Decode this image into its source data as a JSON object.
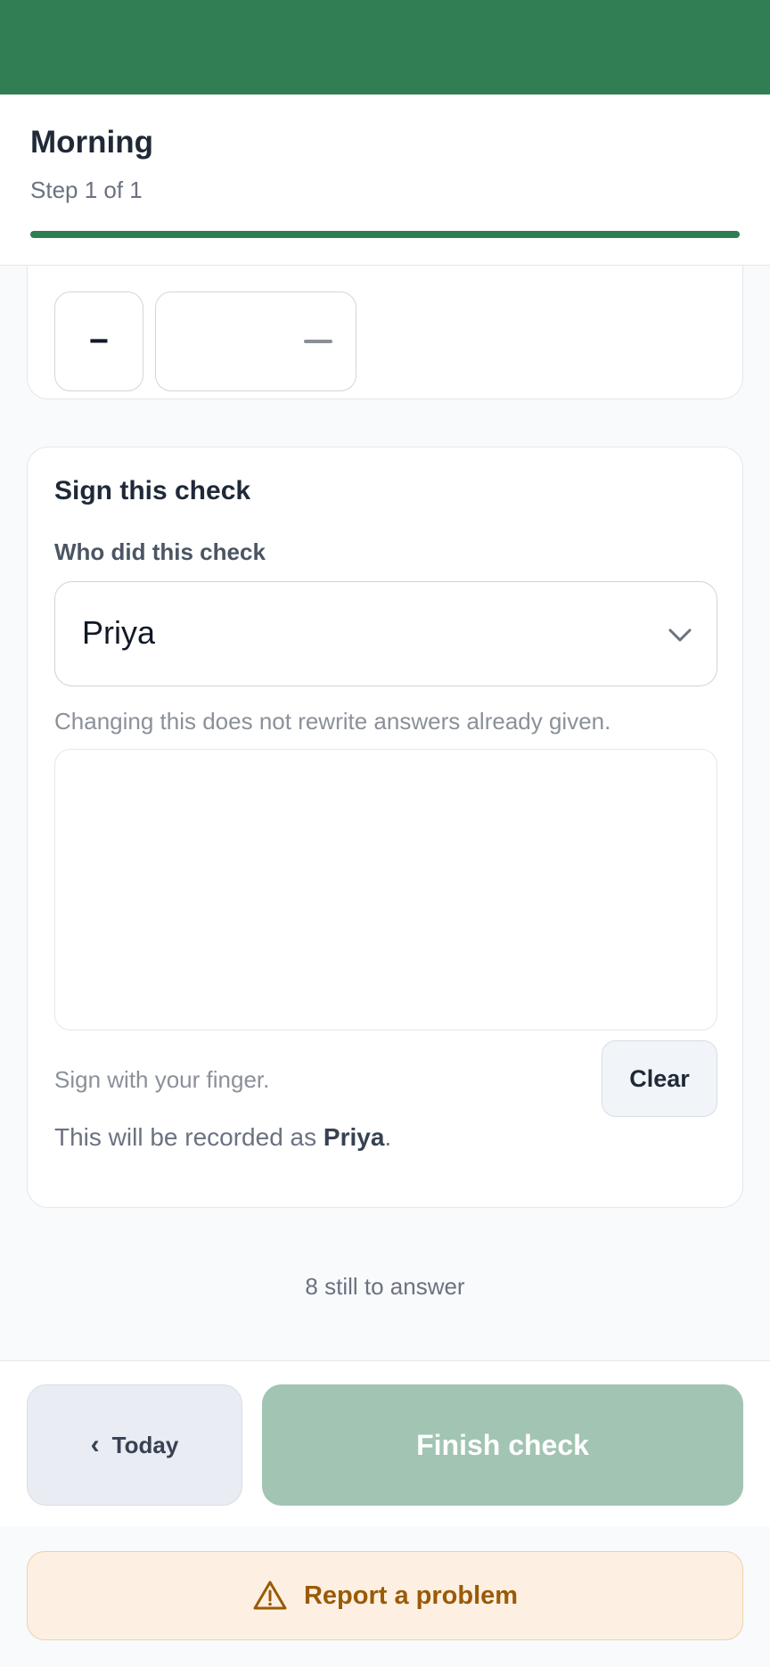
{
  "header": {
    "title": "Morning",
    "step": "Step 1 of 1",
    "progress": 1.0
  },
  "number_input": {
    "minus_label": "−",
    "value_placeholder": "—"
  },
  "sign_card": {
    "title": "Sign this check",
    "who_label": "Who did this check",
    "who_value": "Priya",
    "hint": "Changing this does not rewrite answers already given.",
    "finger_hint": "Sign with your finger.",
    "clear_label": "Clear",
    "recorded_prefix": "This will be recorded as ",
    "recorded_name": "Priya",
    "recorded_suffix": "."
  },
  "remaining_text": "8 still to answer",
  "footer": {
    "back_label": "Today",
    "back_icon": "chevron-left-icon",
    "finish_label": "Finish check",
    "report_label": "Report a problem",
    "report_icon": "warning-icon"
  },
  "colors": {
    "statusbar": "#317e55",
    "accent": "#2f7d53",
    "finish_disabled": "#a2c4b2",
    "report_bg": "#fdf0e2",
    "report_text": "#9a5a06"
  }
}
